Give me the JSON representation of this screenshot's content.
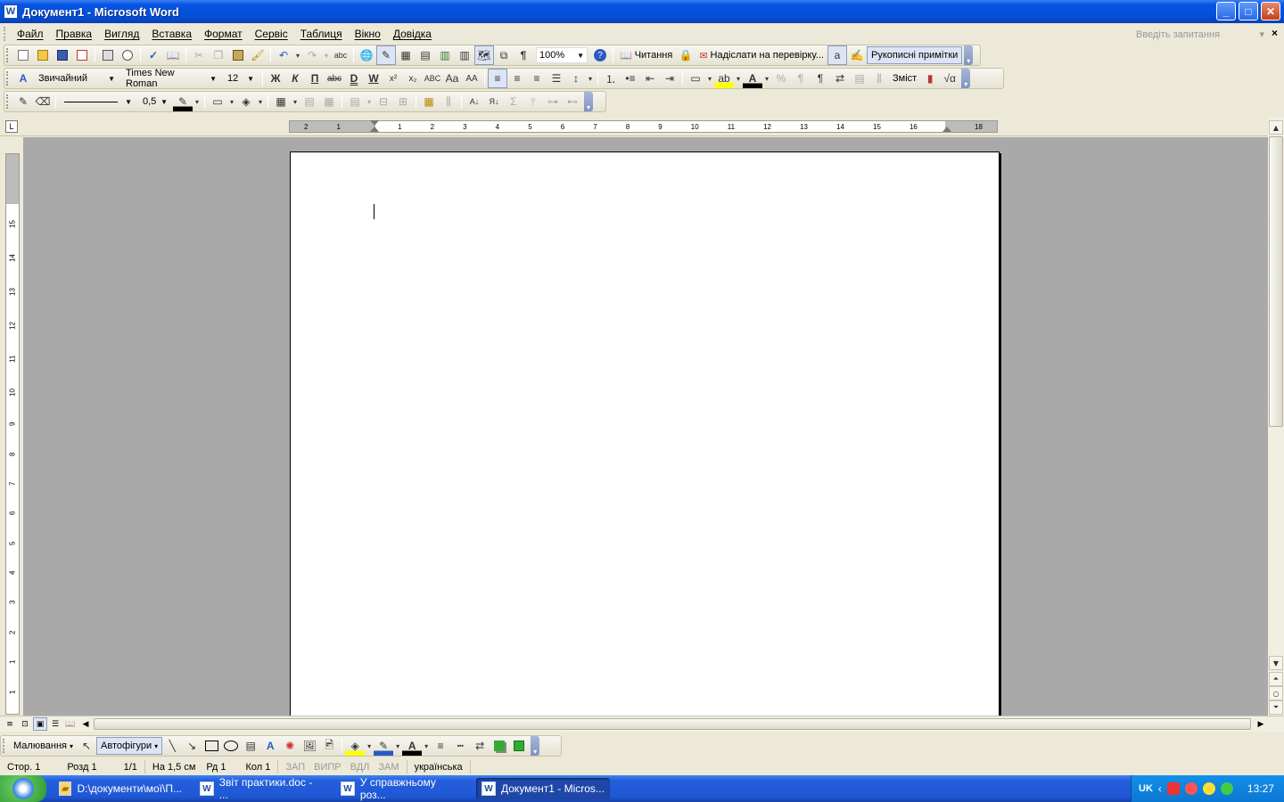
{
  "window": {
    "title": "Документ1 - Microsoft Word",
    "app_icon": "W"
  },
  "window_buttons": {
    "minimize": "_",
    "maximize": "□",
    "close": "✕"
  },
  "menu": {
    "items": [
      {
        "label": "Файл"
      },
      {
        "label": "Правка"
      },
      {
        "label": "Вигляд"
      },
      {
        "label": "Вставка"
      },
      {
        "label": "Формат"
      },
      {
        "label": "Сервіс"
      },
      {
        "label": "Таблиця"
      },
      {
        "label": "Вікно"
      },
      {
        "label": "Довідка"
      }
    ],
    "ask_placeholder": "Введіть запитання",
    "doc_close": "×"
  },
  "standard_toolbar": {
    "zoom": "100%",
    "reading_label": "Читання",
    "send_review_label": "Надіслати на перевірку...",
    "handwriting_label": "Рукописні примітки"
  },
  "formatting_toolbar": {
    "style": "Звичайний",
    "font": "Times New Roman",
    "size": "12",
    "bold": "Ж",
    "italic": "К",
    "underline": "П",
    "toc_label": "Зміст"
  },
  "tables_toolbar": {
    "line_weight": "0,5"
  },
  "hruler": {
    "labels": [
      "2",
      "1",
      "",
      "1",
      "2",
      "3",
      "4",
      "5",
      "6",
      "7",
      "8",
      "9",
      "10",
      "11",
      "12",
      "13",
      "14",
      "15",
      "16",
      "",
      "18"
    ]
  },
  "vruler": {
    "labels": [
      "1",
      "1",
      "2",
      "3",
      "4",
      "5",
      "6",
      "7",
      "8",
      "9",
      "10",
      "11",
      "12",
      "13",
      "14",
      "15"
    ]
  },
  "drawing_toolbar": {
    "drawing_label": "Малювання",
    "autoshapes_label": "Автофігури"
  },
  "status_bar": {
    "page": "Стор. 1",
    "section": "Розд 1",
    "pages": "1/1",
    "at": "На 1,5 см",
    "line": "Рд 1",
    "col": "Кол 1",
    "rec": "ЗАП",
    "trk": "ВИПР",
    "ext": "ВДЛ",
    "ovr": "ЗАМ",
    "language": "українська"
  },
  "taskbar": {
    "tasks": [
      {
        "label": "D:\\документи\\мої\\П...",
        "icon": "folder"
      },
      {
        "label": "Звіт практики.doc - ...",
        "icon": "word"
      },
      {
        "label": "У справжньому роз...",
        "icon": "word"
      },
      {
        "label": "Документ1 - Micros...",
        "icon": "word",
        "active": true
      }
    ],
    "tray_lang": "UK",
    "clock": "13:27"
  },
  "colors": {
    "title_bar": "#0554e3",
    "workspace": "#a9a9a9",
    "taskbar": "#245edb",
    "tray": "#0b77d3"
  }
}
